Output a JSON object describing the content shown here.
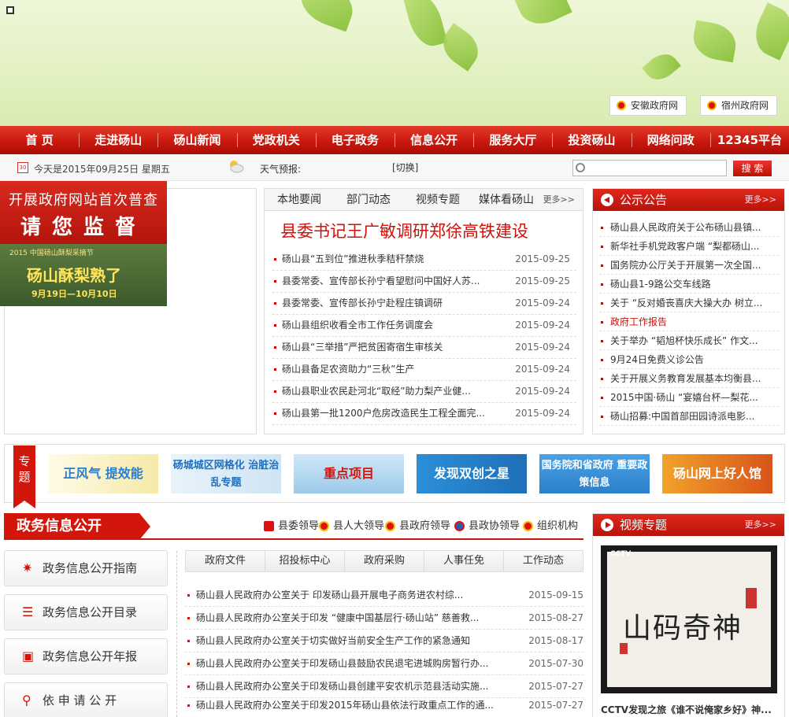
{
  "top_links": [
    {
      "label": "安徽政府网"
    },
    {
      "label": "宿州政府网"
    }
  ],
  "nav": [
    "首 页",
    "走进砀山",
    "砀山新闻",
    "党政机关",
    "电子政务",
    "信息公开",
    "服务大厅",
    "投资砀山",
    "网络问政",
    "12345平台"
  ],
  "infobar": {
    "calendar_day": "30",
    "date_text": "今天是2015年09月25日 星期五",
    "weather_label": "天气预报:",
    "switch_label": "[切换]",
    "search_placeholder": "",
    "search_button": "搜 索"
  },
  "promo": {
    "line1": "开展政府网站首次普查",
    "line2": "请您监督",
    "sub": "2015 中国砀山酥梨采摘节",
    "title": "砀山酥梨熟了",
    "dates": "9月19日—10月10日"
  },
  "news": {
    "tabs": [
      "本地要闻",
      "部门动态",
      "视频专题",
      "媒体看砀山"
    ],
    "more": "更多>>",
    "headline": "县委书记王广敏调研郑徐高铁建设",
    "items": [
      {
        "title": "砀山县“五到位”推进秋季秸秆禁烧",
        "date": "2015-09-25"
      },
      {
        "title": "县委常委、宣传部长孙宁看望慰问中国好人苏...",
        "date": "2015-09-25"
      },
      {
        "title": "县委常委、宣传部长孙宁赴程庄镇调研",
        "date": "2015-09-24"
      },
      {
        "title": "砀山县组织收看全市工作任务调度会",
        "date": "2015-09-24"
      },
      {
        "title": "砀山县“三举措”严把贫困寄宿生审核关",
        "date": "2015-09-24"
      },
      {
        "title": "砀山县备足农资助力“三秋”生产",
        "date": "2015-09-24"
      },
      {
        "title": "砀山县职业农民赴河北“取经”助力梨产业健...",
        "date": "2015-09-24"
      },
      {
        "title": "砀山县第一批1200户危房改造民生工程全面完...",
        "date": "2015-09-24"
      }
    ]
  },
  "notice": {
    "title": "公示公告",
    "more": "更多>>",
    "items": [
      {
        "title": "砀山县人民政府关于公布砀山县镇..."
      },
      {
        "title": "新华社手机党政客户端 “梨都砀山..."
      },
      {
        "title": "国务院办公厅关于开展第一次全国..."
      },
      {
        "title": "砀山县1-9路公交车线路"
      },
      {
        "title": "关于 “反对婚丧喜庆大操大办 树立..."
      },
      {
        "title": "政府工作报告"
      },
      {
        "title": "关于举办 “韬旭杯快乐成长” 作文..."
      },
      {
        "title": "9月24日免费义诊公告"
      },
      {
        "title": "关于开展义务教育发展基本均衡县..."
      },
      {
        "title": "2015中国·砀山 “宴嬉台杯—梨花..."
      },
      {
        "title": "砀山招募:中国首部田园诗派电影..."
      }
    ]
  },
  "topics": {
    "tag": "专题",
    "banners": [
      "正风气 提效能",
      "砀城城区网格化 治脏治乱专题",
      "重点项目",
      "发现双创之星",
      "国务院和省政府 重要政策信息",
      "砀山网上好人馆"
    ]
  },
  "gov": {
    "title": "政务信息公开",
    "links": [
      "县委领导",
      "县人大领导",
      "县政府领导",
      "县政协领导",
      "组织机构"
    ],
    "side_buttons": [
      "政务信息公开指南",
      "政务信息公开目录",
      "政务信息公开年报",
      "依 申 请 公 开"
    ],
    "tabs": [
      "政府文件",
      "招投标中心",
      "政府采购",
      "人事任免",
      "工作动态"
    ],
    "docs": [
      {
        "title": "砀山县人民政府办公室关于 印发砀山县开展电子商务进农村综...",
        "date": "2015-09-15"
      },
      {
        "title": "砀山县人民政府办公室关于印发 “健康中国基层行·砀山站” 慈善救...",
        "date": "2015-08-27"
      },
      {
        "title": "砀山县人民政府办公室关于切实做好当前安全生产工作的紧急通知",
        "date": "2015-08-17"
      },
      {
        "title": "砀山县人民政府办公室关于印发砀山县鼓励农民退宅进城购房暂行办...",
        "date": "2015-07-30"
      },
      {
        "title": "砀山县人民政府办公室关于印发砀山县创建平安农机示范县活动实施...",
        "date": "2015-07-27"
      },
      {
        "title": "砀山县人民政府办公室关于印发2015年砀山县依法行政重点工作的通...",
        "date": "2015-07-27"
      }
    ]
  },
  "video": {
    "title": "视频专题",
    "more": "更多>>",
    "logo": "CCTV",
    "calligraphy": "山码奇神",
    "caption": "CCTV发现之旅《谁不说俺家乡好》神..."
  },
  "colors": {
    "brand_red": "#d2160c",
    "headline_red": "#d0100a"
  }
}
